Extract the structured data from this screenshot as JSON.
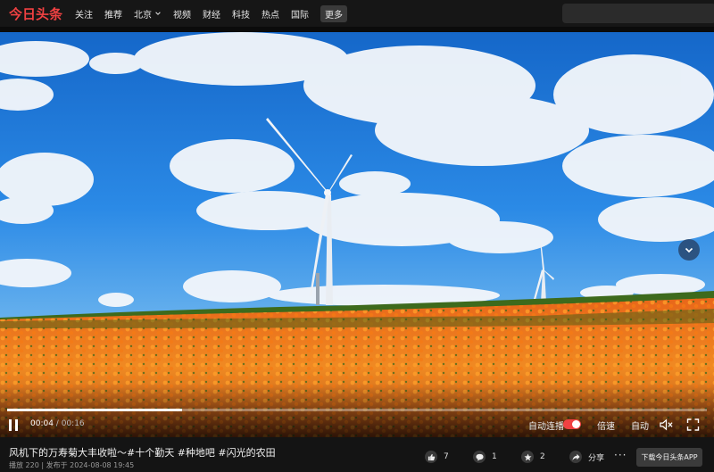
{
  "header": {
    "logo": "今日头条",
    "nav": [
      "关注",
      "推荐",
      "北京",
      "视频",
      "财经",
      "科技",
      "热点",
      "国际"
    ],
    "more": "更多",
    "search_placeholder": ""
  },
  "player": {
    "progress_fraction": 0.25,
    "current_time": "00:04",
    "separator": " / ",
    "total_time": "00:16",
    "autoplay_label": "自动连播",
    "autoplay_on": true,
    "speed_label": "倍速",
    "quality_label": "自动"
  },
  "video": {
    "title": "风机下的万寿菊大丰收啦～#十个勤天 #种地吧 #闪光的农田",
    "views_label": "播放 220",
    "separator": "|",
    "published": "发布于 2024-08-08 19:45"
  },
  "actions": {
    "likes": "7",
    "comments": "1",
    "favorites": "2",
    "share_label": "分享",
    "more": "···",
    "download_label": "下载今日头条APP"
  },
  "colors": {
    "brand": "#f04142",
    "sky": "#1e7ad8",
    "flowers": "#f07a1a"
  }
}
